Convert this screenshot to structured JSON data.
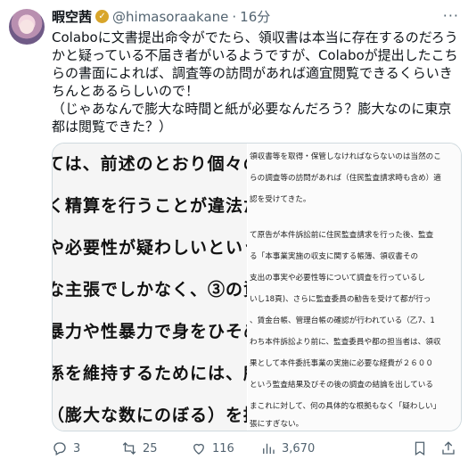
{
  "author": {
    "name": "暇空茜",
    "handle": "@himasoraakane",
    "separator": "·",
    "time": "16分"
  },
  "tweet_text": "Colaboに文書提出命令がでたら、領収書は本当に存在するのだろうかと疑っている不届き者がいるようですが、Colaboが提出したこちらの書面によれば、調査等の訪問があれば適宜閲覧できるくらいきちんとあるらしいので！\n（じゃあなんで膨大な時間と紙が必要なんだろう？膨大なのに東京都は閲覧できた？）",
  "image": {
    "left_lines": [
      "ては、前述のとおり個々の",
      "く精算を行うことが違法だ",
      "や必要性が疑わしいという",
      "な主張でしかなく、③の資",
      "暴力や性暴力で身をひそめ",
      "係を維持するためには、所",
      "（膨大な数にのぼる）を提"
    ],
    "right_lines": [
      "領収書等を取得・保管しなければならないのは当然のこ",
      "らの調査等の訪問があれば（住民監査請求時も含め）適",
      "認を受けてきた。",
      "て原告が本件訴訟前に住民監査請求を行った後、監査",
      "る「本事業実施の収支に関する帳簿、領収書その",
      "支出の事実や必要性等について調査を行っているし",
      "いし18頁)、さらに監査委員の勧告を受けて都が行っ",
      "、賃金台帳、管理台帳の確認が行われている（乙7、1",
      "わち本件訴訟より前に、監査委員や都の担当者は、領収",
      "果として本件委託事業の実施に必要な経費が２６００",
      "という監査結果及びその後の調査の結論を出している",
      "まこれに対して、何の具体的な根拠もなく「疑わしい」",
      "張にすぎない。"
    ]
  },
  "stats": {
    "replies": "3",
    "retweets": "25",
    "likes": "116",
    "views": "3,670"
  },
  "colors": {
    "verified_badge": "#d8a52a",
    "secondary_text": "#536471"
  }
}
